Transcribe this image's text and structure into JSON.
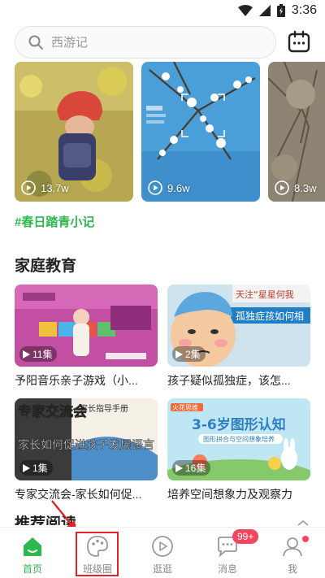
{
  "status_bar": {
    "time": "3:36"
  },
  "search": {
    "placeholder": "西游记"
  },
  "featured_videos": [
    {
      "play_count": "13.7w"
    },
    {
      "play_count": "9.6w"
    },
    {
      "play_count": "8.3w"
    }
  ],
  "topic_tag": "#春日踏青小记",
  "section": {
    "title": "家庭教育",
    "courses": [
      {
        "episodes": "11集",
        "title": "予阳音乐亲子游戏（小..."
      },
      {
        "episodes": "2集",
        "title": "孩子疑似孤独症，该怎..."
      },
      {
        "episodes": "1集",
        "title": "专家交流会-家长如何促..."
      },
      {
        "episodes": "16集",
        "title": "培养空间想象力及观察力"
      }
    ]
  },
  "thumb_text": {
    "c2_banner": "孤独症孩如何相",
    "c2_top": "天注“星星何我",
    "c3_line1": "专家交流会",
    "c3_line2": "家长如何促进孩子发展语言",
    "c3_handbook": "家长指导手册",
    "c4_brand": "火花思维",
    "c4_headline": "3-6岁图形认知",
    "c4_sub": "图形拼合与空间想象培养"
  },
  "next_section_title": "推荐阅读",
  "bottom_nav": {
    "items": [
      {
        "label": "首页"
      },
      {
        "label": "班级圈"
      },
      {
        "label": "逛逛"
      },
      {
        "label": "消息",
        "badge": "99+"
      },
      {
        "label": "我"
      }
    ]
  },
  "colors": {
    "accent": "#2db84f",
    "badge": "#f5455c",
    "highlight": "#e0242b"
  }
}
